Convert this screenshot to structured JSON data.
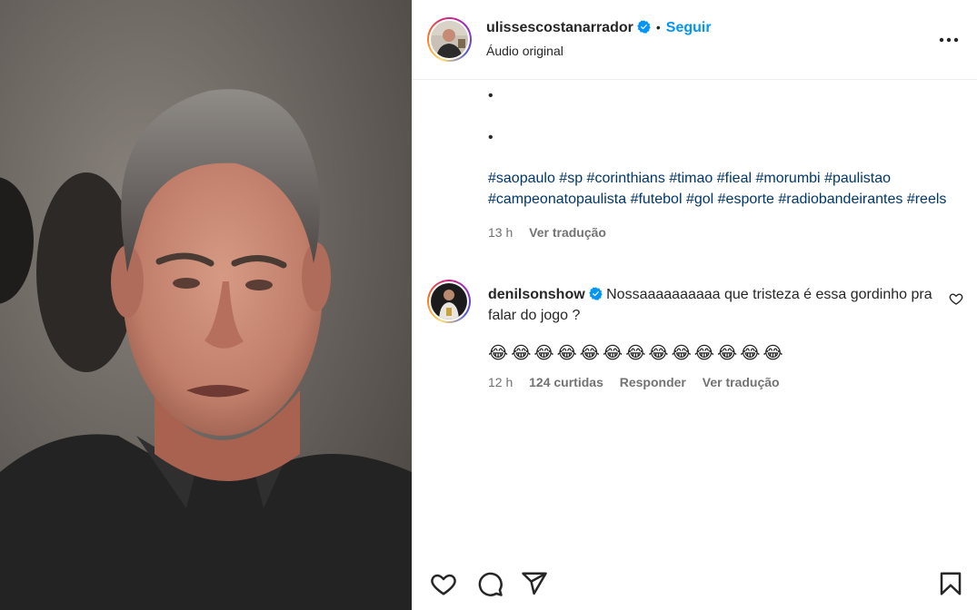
{
  "header": {
    "username": "ulissescostanarrador",
    "separator": "•",
    "follow_label": "Seguir",
    "audio_label": "Áudio original"
  },
  "caption": {
    "bullets": [
      "•",
      "•"
    ],
    "hashtags": [
      "#saopaulo",
      "#sp",
      "#corinthians",
      "#timao",
      "#fieal",
      "#morumbi",
      "#paulistao",
      "#campeonatopaulista",
      "#futebol",
      "#gol",
      "#esporte",
      "#radiobandeirantes",
      "#reels"
    ],
    "time": "13 h",
    "translate_label": "Ver tradução"
  },
  "comment": {
    "username": "denilsonshow",
    "text": "Nossaaaaaaaaaa que tristeza é essa gordinho pra falar do jogo ?",
    "emojis": "😂😂😂😂😂😂😂😂😂😂😂😂😂",
    "time": "12 h",
    "likes": "124 curtidas",
    "reply_label": "Responder",
    "translate_label": "Ver tradução"
  },
  "icons": {
    "verified": "verified-badge-icon",
    "more": "more-options-icon",
    "comment_like": "heart-outline-icon",
    "like": "heart-icon",
    "comment": "comment-icon",
    "share": "share-icon",
    "save": "bookmark-icon"
  },
  "colors": {
    "link_blue": "#0095f6",
    "hashtag": "#00376b",
    "secondary_text": "#737373",
    "verified_blue": "#0095f6"
  }
}
